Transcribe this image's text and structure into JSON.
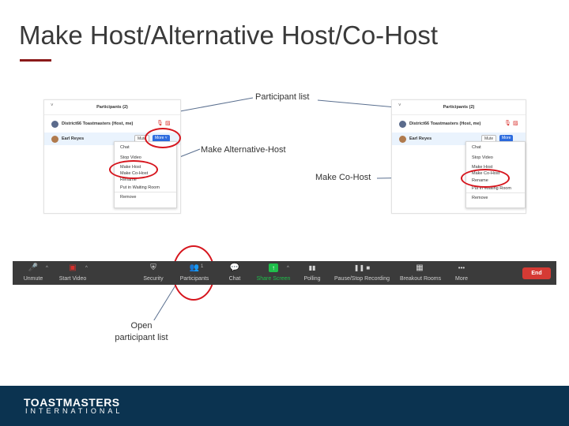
{
  "slide": {
    "title": "Make Host/Alternative Host/Co-Host",
    "accent_color": "#8b1a1a",
    "annotation_color": "#d6151d"
  },
  "callouts": {
    "participant_list": "Participant list",
    "make_alternative_host": "Make Alternative-Host",
    "make_co_host": "Make Co-Host",
    "open_participant_list": "Open participant list"
  },
  "left_panel": {
    "caret": "˅",
    "header": "Participants (2)",
    "participants": [
      {
        "name": "District66 Toastmasters (Host, me)",
        "avatar_color": "#5b6b8c"
      },
      {
        "name": "Earl Reyes",
        "avatar_color": "#b07a4d"
      }
    ],
    "mute_label": "Mute",
    "more_label": "More ˅",
    "menu": [
      "Chat",
      "Stop Video",
      "Make Host",
      "Make Co-Host",
      "Rename",
      "Put in Waiting Room",
      "Remove"
    ]
  },
  "right_panel": {
    "caret": "˅",
    "header": "Participants (2)",
    "participants": [
      {
        "name": "District66 Toastmasters (Host, me)",
        "avatar_color": "#5b6b8c"
      },
      {
        "name": "Earl Reyes",
        "avatar_color": "#b07a4d"
      }
    ],
    "mute_label": "Mute",
    "more_label": "More",
    "menu": [
      "Chat",
      "Stop Video",
      "Make Host",
      "Make Co-Host",
      "Rename",
      "Put in Waiting Room",
      "Remove"
    ]
  },
  "toolbar": {
    "items": [
      {
        "label": "Unmute",
        "icon": "🎤"
      },
      {
        "label": "Start Video",
        "icon": "▣"
      },
      {
        "label": "Security",
        "icon": "⛨"
      },
      {
        "label": "Participants",
        "icon": "👥",
        "count": "1"
      },
      {
        "label": "Chat",
        "icon": "💬"
      },
      {
        "label": "Share Screen",
        "icon": "↑"
      },
      {
        "label": "Polling",
        "icon": "▮▮"
      },
      {
        "label": "Pause/Stop Recording",
        "icon": "❚❚ ■"
      },
      {
        "label": "Breakout Rooms",
        "icon": "▦"
      },
      {
        "label": "More",
        "icon": "•••"
      }
    ],
    "end_label": "End",
    "chevron": "^",
    "share_color": "#1fbf4b"
  },
  "footer": {
    "logo_top": "TOASTMASTERS",
    "logo_bottom": "INTERNATIONAL",
    "background": "#0b3350"
  }
}
